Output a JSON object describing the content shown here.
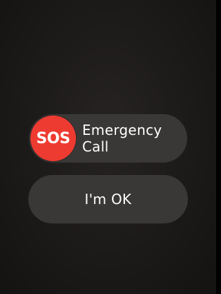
{
  "emergency_slider": {
    "knob_label": "SOS",
    "label_line1": "Emergency",
    "label_line2": "Call"
  },
  "ok_button": {
    "label": "I'm OK"
  },
  "colors": {
    "sos_red": "#ee3b31",
    "pill_gray": "#3a3837",
    "background": "#1c1a19",
    "text": "#ffffff"
  }
}
